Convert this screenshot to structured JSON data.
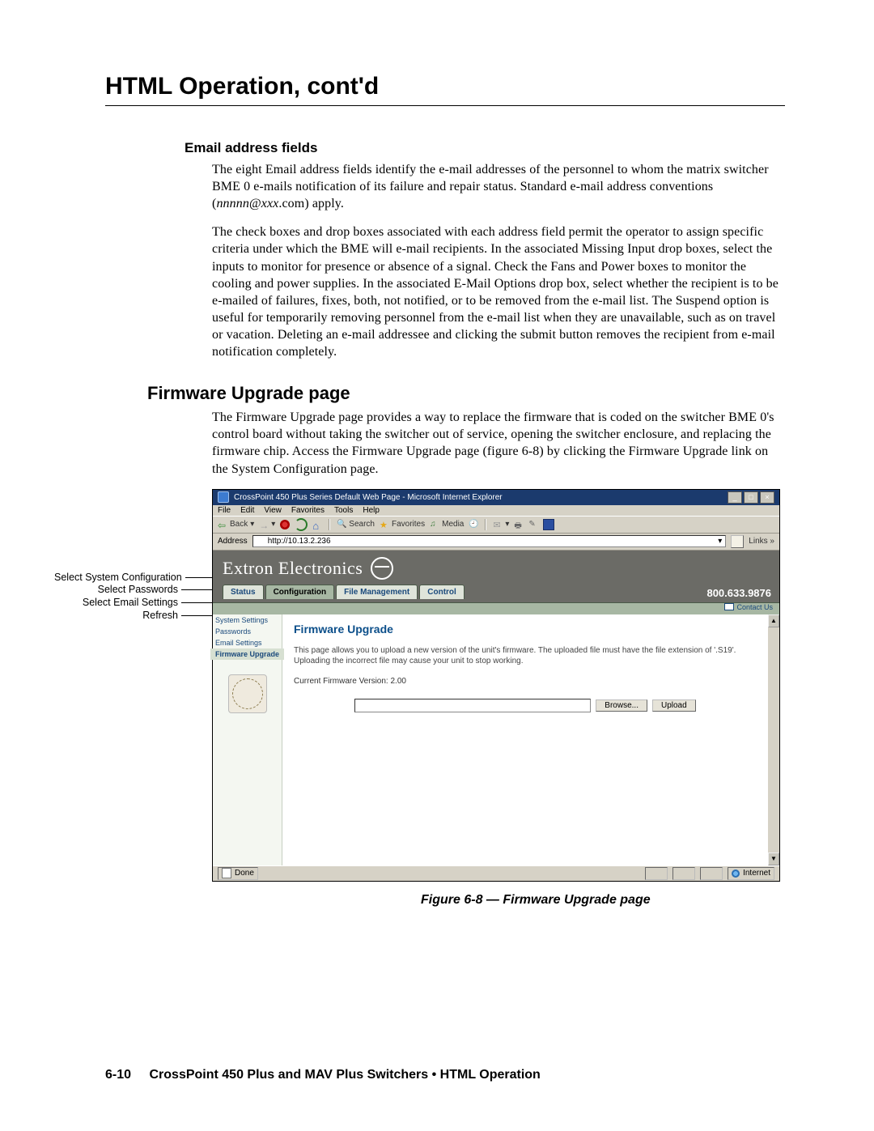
{
  "page_title": "HTML Operation, cont'd",
  "sections": {
    "email_fields": {
      "heading": "Email address fields",
      "para1": "The eight Email address fields identify the e-mail addresses of the personnel to whom the matrix switcher BME 0 e-mails notification of its failure and repair status. Standard e-mail address conventions (",
      "para1_em": "nnnnn@xxx",
      "para1_tail": ".com) apply.",
      "para2": "The check boxes and drop boxes associated with each address field permit the operator to assign specific criteria under which the BME will e-mail recipients.  In the associated Missing Input drop boxes, select the inputs to monitor for presence or absence of a signal.  Check the Fans and Power boxes to monitor the cooling and power supplies.  In the associated E-Mail Options drop box, select whether the recipient is to be e-mailed of failures, fixes, both, not notified, or to be removed from the e-mail list.  The Suspend option is useful for temporarily removing personnel from the e-mail list when they are unavailable, such as on travel or vacation. Deleting an e-mail addressee and clicking the submit button removes the recipient from e-mail notification completely."
    },
    "firmware": {
      "heading": "Firmware Upgrade page",
      "para": "The Firmware Upgrade page provides a way to replace the firmware that is coded on the switcher BME 0's control board without taking the switcher out of service, opening the switcher enclosure, and replacing the firmware chip.  Access the Firmware Upgrade page (figure 6-8) by clicking the Firmware Upgrade link on the System Configuration page."
    }
  },
  "callouts": {
    "c0": "Select System Configuration",
    "c1": "Select Passwords",
    "c2": "Select Email Settings",
    "c3": "Refresh"
  },
  "ie": {
    "title": "CrossPoint 450 Plus Series Default Web Page - Microsoft Internet Explorer",
    "menu": {
      "file": "File",
      "edit": "Edit",
      "view": "View",
      "favorites": "Favorites",
      "tools": "Tools",
      "help": "Help"
    },
    "toolbar": {
      "back": "Back",
      "search": "Search",
      "favorites": "Favorites",
      "media": "Media"
    },
    "address_label": "Address",
    "address_value": "http://10.13.2.236",
    "links_label": "Links",
    "brand": "Extron Electronics",
    "phone": "800.633.9876",
    "tabs": {
      "status": "Status",
      "config": "Configuration",
      "filemgmt": "File Management",
      "control": "Control"
    },
    "contact": "Contact Us",
    "sidebar": {
      "s0": "System Settings",
      "s1": "Passwords",
      "s2": "Email Settings",
      "s3": "Firmware Upgrade"
    },
    "main": {
      "heading": "Firmware Upgrade",
      "desc": "This page allows you to upload a new version of the unit's firmware. The uploaded file must have the file extension of '.S19'. Uploading the incorrect file may cause your unit to stop working.",
      "version_label": "Current Firmware Version: 2.00",
      "browse": "Browse...",
      "upload": "Upload"
    },
    "status": {
      "done": "Done",
      "zone": "Internet"
    }
  },
  "figure_caption": "Figure 6-8 — Firmware Upgrade page",
  "footer": {
    "page_number": "6-10",
    "text": "CrossPoint 450 Plus and MAV Plus Switchers • HTML Operation"
  }
}
